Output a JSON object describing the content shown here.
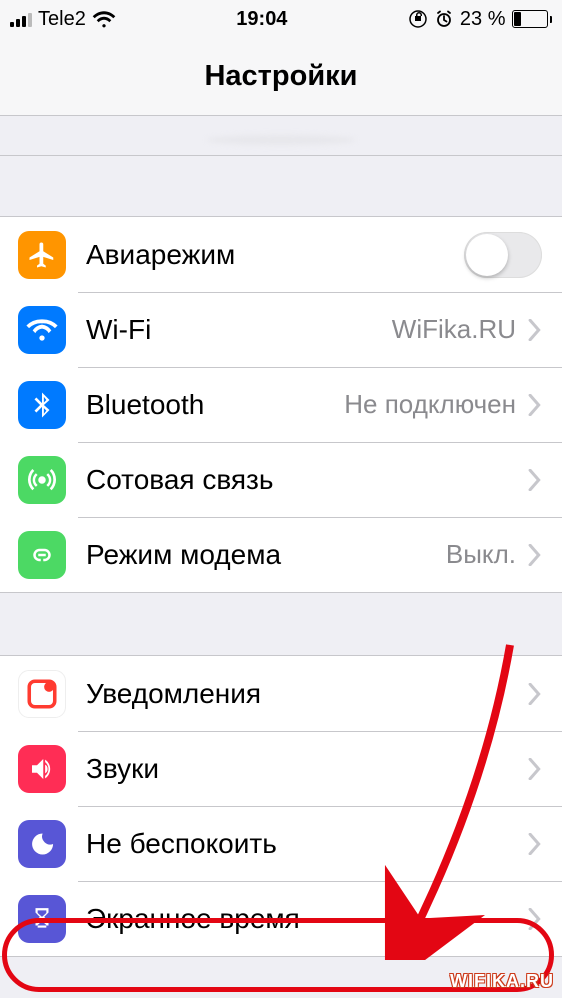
{
  "status": {
    "carrier": "Tele2",
    "time": "19:04",
    "battery_percent": "23 %"
  },
  "header": {
    "title": "Настройки"
  },
  "group1": {
    "airplane": {
      "label": "Авиарежим",
      "icon": "airplane-icon",
      "color": "#ff9500"
    },
    "wifi": {
      "label": "Wi-Fi",
      "value": "WiFika.RU",
      "icon": "wifi-icon",
      "color": "#007aff"
    },
    "bluetooth": {
      "label": "Bluetooth",
      "value": "Не подключен",
      "icon": "bluetooth-icon",
      "color": "#007aff"
    },
    "cellular": {
      "label": "Сотовая связь",
      "value": "",
      "icon": "antenna-icon",
      "color": "#4cd964"
    },
    "hotspot": {
      "label": "Режим модема",
      "value": "Выкл.",
      "icon": "link-icon",
      "color": "#4cd964"
    }
  },
  "group2": {
    "notifications": {
      "label": "Уведомления",
      "icon": "notification-icon",
      "color": "#ff3b30"
    },
    "sounds": {
      "label": "Звуки",
      "icon": "speaker-icon",
      "color": "#ff2d55"
    },
    "dnd": {
      "label": "Не беспокоить",
      "icon": "moon-icon",
      "color": "#5856d6"
    },
    "screentime": {
      "label": "Экранное время",
      "icon": "hourglass-icon",
      "color": "#5856d6"
    }
  },
  "watermark": "WIFIKA.RU"
}
